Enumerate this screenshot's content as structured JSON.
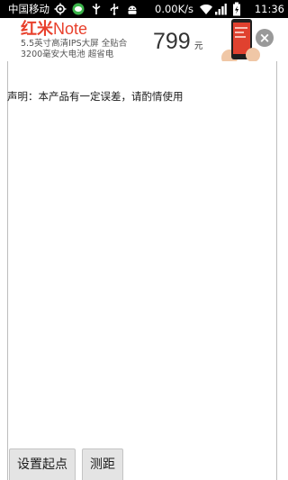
{
  "status_bar": {
    "carrier": "中国移动",
    "network_speed": "0.00K/s",
    "time": "11:36"
  },
  "ad": {
    "brand": "红米",
    "model": "Note",
    "line1": "5.5英寸高清IPS大屏 全贴合",
    "line2": "3200毫安大电池 超省电",
    "price": "799",
    "price_unit": "元",
    "close_label": "×"
  },
  "main": {
    "disclaimer": "声明：本产品有一定误差，请酌情使用"
  },
  "actions": {
    "set_start_label": "设置起点",
    "measure_label": "测距"
  },
  "colors": {
    "brand_red": "#e8402c",
    "status_bar_bg": "#000000",
    "button_bg": "#e4e4e4"
  }
}
